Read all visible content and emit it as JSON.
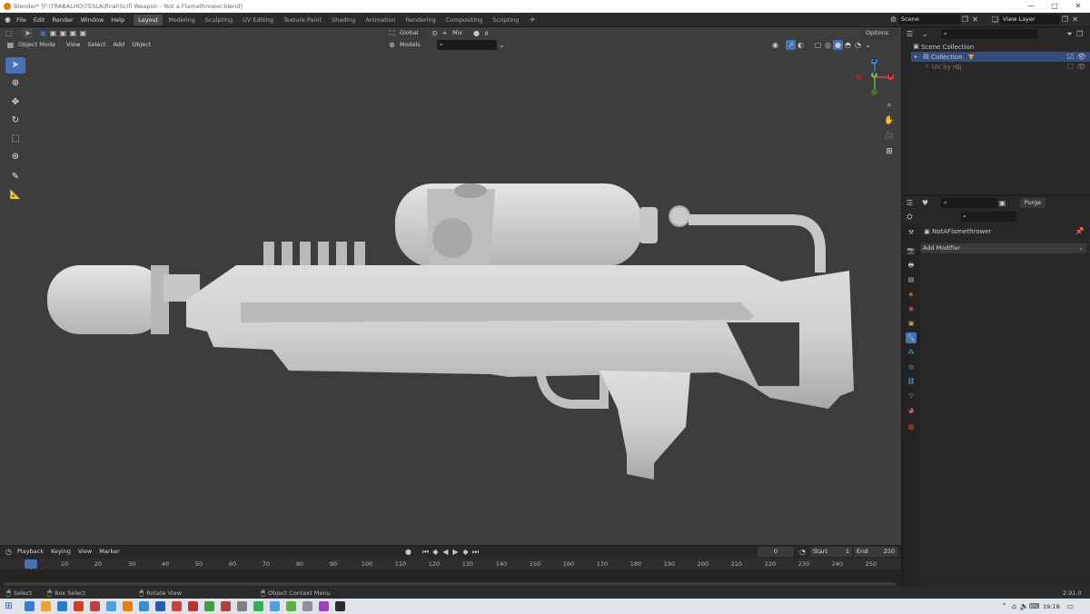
{
  "window": {
    "title": "Blender* [F:\\TRABALHO\\TESLA\\final\\Scifi Weapon - Not a Flamethrower.blend]",
    "controls": [
      "—",
      "□",
      "✕"
    ]
  },
  "menu": [
    "File",
    "Edit",
    "Render",
    "Window",
    "Help"
  ],
  "workspaces": [
    "Layout",
    "Modeling",
    "Sculpting",
    "UV Editing",
    "Texture Paint",
    "Shading",
    "Animation",
    "Rendering",
    "Compositing",
    "Scripting"
  ],
  "active_workspace": "Layout",
  "scene": {
    "name": "Scene",
    "view_layer": "View Layer"
  },
  "viewport": {
    "mode": "Object Mode",
    "header_menu": [
      "View",
      "Select",
      "Add",
      "Object"
    ],
    "transform_orientation": "Global",
    "snap_target": "Mix",
    "collection_filter": "Models",
    "options_label": "Options",
    "tools": [
      "select-box",
      "cursor",
      "move",
      "rotate",
      "scale",
      "transform",
      "annotate",
      "measure"
    ],
    "gizmo_axes": [
      "Z",
      "Y",
      "X"
    ]
  },
  "outliner": {
    "root": "Scene Collection",
    "items": [
      {
        "label": "Collection",
        "type": "collection"
      },
      {
        "label": "UV by rBJ",
        "type": "object"
      }
    ]
  },
  "properties": {
    "object_name": "NotAFlamethrower",
    "add_modifier_label": "Add Modifier",
    "purge_label": "Purge",
    "tab_colors": [
      "#c8c8c8",
      "#c8c8c8",
      "#c8c8c8",
      "#d08040",
      "#c05050",
      "#e0a040",
      "#4a9fe0",
      "#c8c8c8",
      "#6ab4e0",
      "#6ab4e0",
      "#60d060",
      "#d06070",
      "#c04040"
    ]
  },
  "timeline": {
    "menu": [
      "Playback",
      "Keying",
      "View",
      "Marker"
    ],
    "current_frame": "0",
    "start_label": "Start",
    "start": "1",
    "end_label": "End",
    "end": "250",
    "ticks": [
      "0",
      "10",
      "20",
      "30",
      "40",
      "50",
      "60",
      "70",
      "80",
      "90",
      "100",
      "110",
      "120",
      "130",
      "140",
      "150",
      "160",
      "170",
      "180",
      "190",
      "200",
      "210",
      "220",
      "230",
      "240",
      "250"
    ]
  },
  "status": {
    "select": "Select",
    "box_select": "Box Select",
    "rotate_view": "Rotate View",
    "context_menu": "Object Context Menu",
    "version": "2.91.0"
  },
  "taskbar": {
    "time": "19:18",
    "app_colors": [
      "#3a7bd5",
      "#f0a030",
      "#2a7cd0",
      "#d04020",
      "#c04040",
      "#4a9fe0",
      "#e87d0d",
      "#3a8ad0",
      "#2a5ab0",
      "#d04040",
      "#c03030",
      "#40a040",
      "#b04040",
      "#808080",
      "#30b050",
      "#4a9fe0",
      "#60b040",
      "#909090",
      "#a040c0",
      "#2a2a2a"
    ]
  },
  "colors": {
    "accent": "#4772b3",
    "viewport_bg": "#3d3d3d",
    "panel_bg": "#282828",
    "model": "#c9c9c9"
  }
}
